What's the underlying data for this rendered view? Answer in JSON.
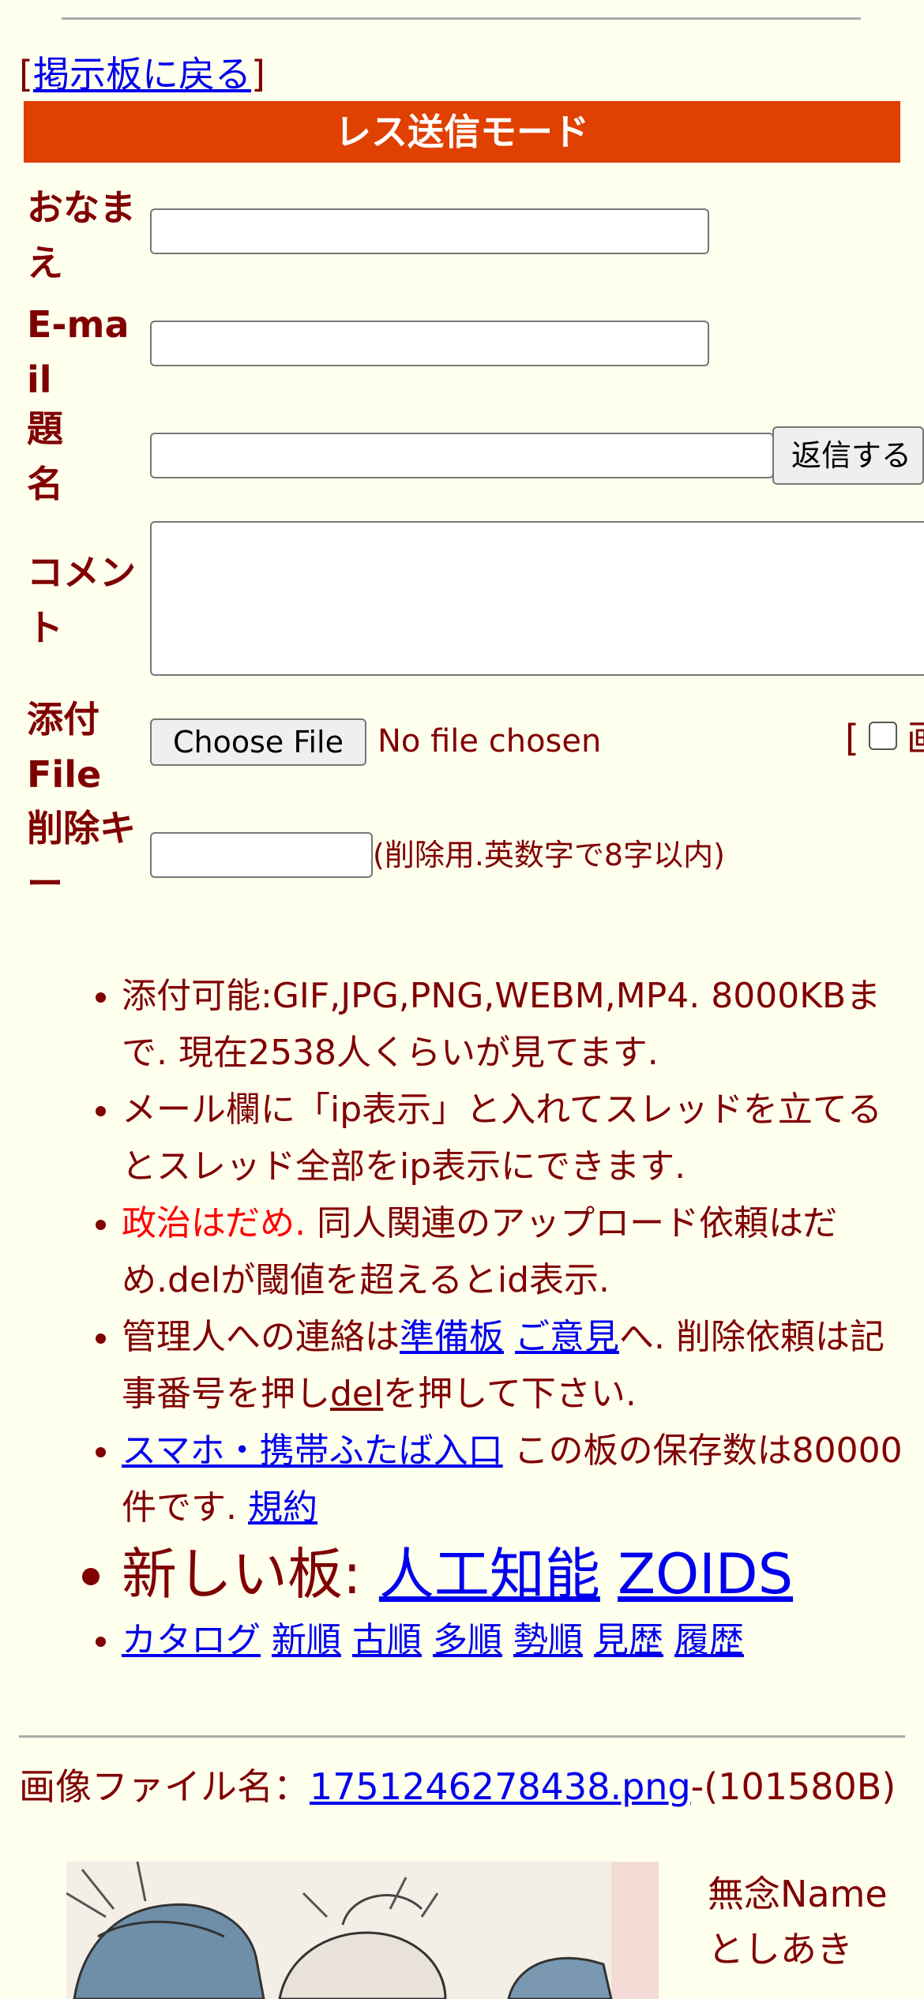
{
  "nav": {
    "back_open": "[",
    "back_link": "掲示板に戻る",
    "back_close": "]"
  },
  "form": {
    "mode_title": "レス送信モード",
    "name_label": "おなまえ",
    "email_label": "E-mail",
    "subject_label": "題名",
    "submit_label": "返信する",
    "comment_label": "コメント",
    "file_label": "添付File",
    "choose_file_label": "Choose File",
    "no_file_text": "No file chosen",
    "option_bracket": "[",
    "option_cut_text": "画",
    "delete_label": "削除キー",
    "delete_note": "(削除用.英数字で8字以内)"
  },
  "info": {
    "line1": "添付可能:GIF,JPG,PNG,WEBM,MP4. 8000KBまで. 現在2538人くらいが見てます.",
    "line2": "メール欄に「ip表示」と入れてスレッドを立てるとスレッド全部をip表示にできます.",
    "line3_red": "政治はだめ.",
    "line3_rest": " 同人関連のアップロード依頼はだめ.delが閾値を超えるとid表示.",
    "line4_pre": "管理人への連絡は",
    "line4_link1": "準備板",
    "line4_link2": "ご意見",
    "line4_mid": "へ. 削除依頼は記事番号を押し",
    "line4_link3": "del",
    "line4_post": "を押して下さい.",
    "line5_link": "スマホ・携帯ふたば入口",
    "line5_mid": " この板の保存数は80000件です. ",
    "line5_link2": "規約",
    "new_boards_label": "新しい板: ",
    "new_board_1": "人工知能",
    "new_board_2": "ZOIDS",
    "sort_links": [
      "カタログ",
      "新順",
      "古順",
      "多順",
      "勢順",
      "見歴",
      "履歴"
    ]
  },
  "post": {
    "file_prefix": "画像ファイル名：",
    "file_name": "1751246278438.png",
    "file_size": "-(101580B)",
    "name_line1": "無念Name",
    "name_line2": "としあき"
  }
}
